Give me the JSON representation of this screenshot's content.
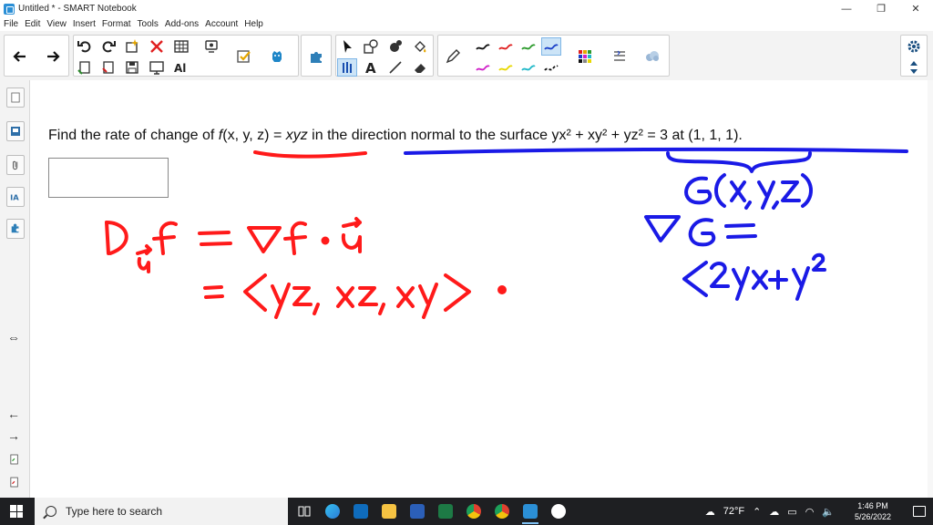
{
  "window": {
    "title": "Untitled * - SMART Notebook",
    "minimize": "—",
    "restore": "❐",
    "close": "✕"
  },
  "menu": [
    "File",
    "Edit",
    "View",
    "Insert",
    "Format",
    "Tools",
    "Add-ons",
    "Account",
    "Help"
  ],
  "problem": {
    "lead": "Find the rate of change of ",
    "func": "f",
    "func_args": "(x, y, z)",
    "eq": " = ",
    "func_body": "xyz",
    "mid": " in the direction normal to the surface ",
    "surface": "yx² + xy² + yz² = 3",
    "tail": " at (1, 1, 1)."
  },
  "taskbar": {
    "search_placeholder": "Type here to search",
    "weather": "72°F",
    "time": "1:46 PM",
    "date": "5/26/2022"
  },
  "colors": {
    "red_ink": "#ff1a1a",
    "blue_ink": "#1a1ae6",
    "taskbar": "#1e1f22"
  }
}
